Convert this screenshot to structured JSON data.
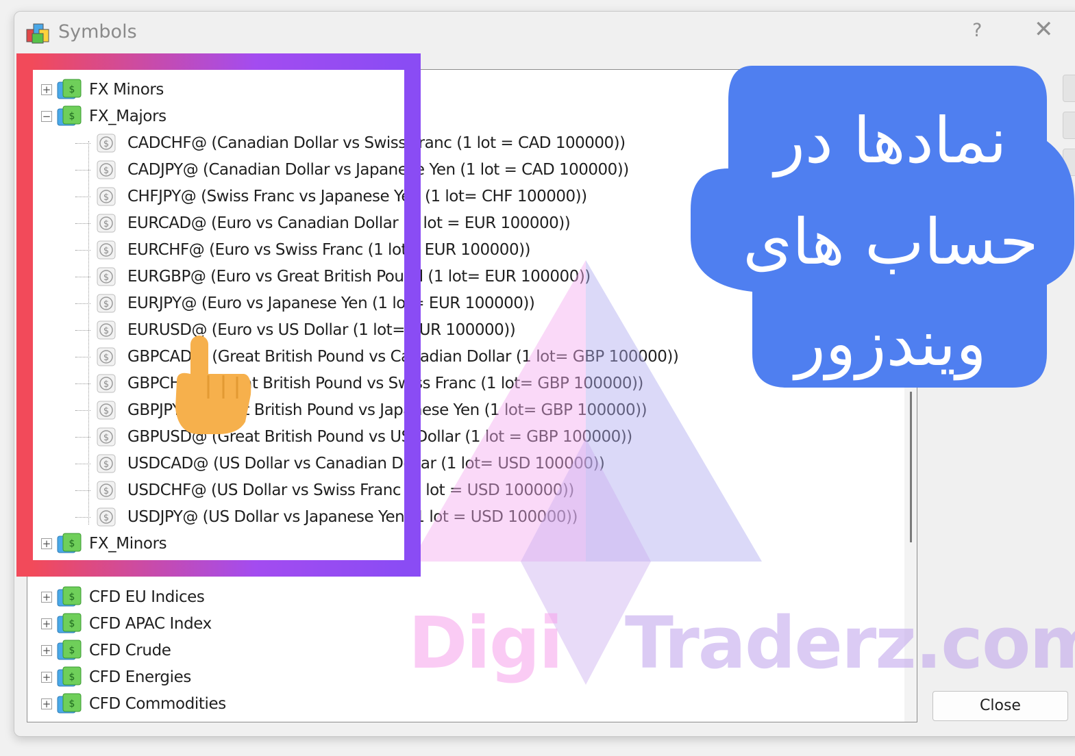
{
  "window": {
    "title": "Symbols",
    "help_label": "?",
    "close_glyph": "✕"
  },
  "tree": {
    "top_group": "FX Minors",
    "expanded_group": "FX_Majors",
    "symbols": [
      "CADCHF@  (Canadian Dollar vs Swiss Franc  (1 lot = CAD 100000))",
      "CADJPY@  (Canadian Dollar vs Japanese Yen (1 lot = CAD 100000))",
      "CHFJPY@  (Swiss Franc vs Japanese Yen (1 lot= CHF 100000))",
      "EURCAD@  (Euro vs Canadian Dollar (1 lot = EUR 100000))",
      "EURCHF@  (Euro vs Swiss Franc (1 lot= EUR 100000))",
      "EURGBP@  (Euro vs Great British Pound (1 lot= EUR 100000))",
      "EURJPY@  (Euro vs Japanese Yen (1 lot= EUR 100000))",
      "EURUSD@  (Euro vs US Dollar (1 lot= EUR 100000))",
      "GBPCAD@  (Great British Pound vs Canadian Dollar  (1 lot= GBP 100000))",
      "GBPCHF@  (Great British Pound vs Swiss Franc (1 lot= GBP 100000))",
      "GBPJPY@  (Great British Pound vs Japanese Yen (1 lot= GBP 100000))",
      "GBPUSD@  (Great British Pound vs US Dollar (1 lot = GBP 100000))",
      "USDCAD@  (US Dollar vs Canadian Dollar  (1 lot= USD 100000))",
      "USDCHF@  (US Dollar vs Swiss Franc  (1 lot = USD 100000))",
      "USDJPY@  (US Dollar vs Japanese Yen (1 lot = USD 100000))"
    ],
    "groups_after": [
      "FX_Minors",
      "CFD EU Indices",
      "CFD APAC Index",
      "CFD Crude",
      "CFD Energies",
      "CFD Commodities"
    ]
  },
  "buttons": {
    "close_label": "Close"
  },
  "overlay": {
    "badge_lines": [
      "نمادها در",
      "حساب های",
      "ویندزور"
    ],
    "watermark_digi": "Digi",
    "watermark_traderz": "Traderz.com",
    "badge_color": "#4f7ff0",
    "frame_colors": [
      "#f24a5a",
      "#8a4cf4"
    ]
  }
}
